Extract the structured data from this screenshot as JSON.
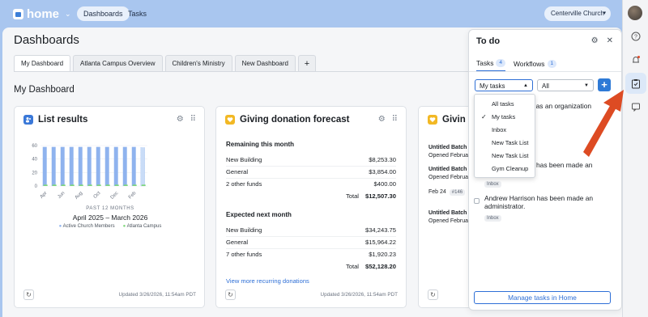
{
  "topbar": {
    "app_name": "home",
    "nav": [
      "Dashboards",
      "Tasks"
    ],
    "church_selector": "Centerville Church"
  },
  "page": {
    "title": "Dashboards",
    "tabs": [
      "My Dashboard",
      "Atlanta Campus Overview",
      "Children's Ministry",
      "New Dashboard",
      "+"
    ],
    "section_title": "My Dashboard"
  },
  "cards": {
    "list_results": {
      "title": "List results",
      "footer_period": "PAST 12 MONTHS",
      "footer_range": "April 2025 – March 2026",
      "updated": "Updated 3/26/2026, 11:54am PDT"
    },
    "giving_forecast": {
      "title": "Giving donation forecast",
      "remaining_header": "Remaining this month",
      "remaining_rows": [
        {
          "label": "New Building",
          "value": "$8,253.30"
        },
        {
          "label": "General",
          "value": "$3,854.00"
        },
        {
          "label": "2 other funds",
          "value": "$400.00"
        }
      ],
      "remaining_total_label": "Total",
      "remaining_total": "$12,507.30",
      "expected_header": "Expected next month",
      "expected_rows": [
        {
          "label": "New Building",
          "value": "$34,243.75"
        },
        {
          "label": "General",
          "value": "$15,964.22"
        },
        {
          "label": "7 other funds",
          "value": "$1,920.23"
        }
      ],
      "expected_total_label": "Total",
      "expected_total": "$52,128.20",
      "link": "View more recurring donations",
      "updated": "Updated 3/26/2026, 11:54am PDT"
    },
    "third": {
      "title": "Givin",
      "rows": [
        "Untitled Batch",
        "Opened Februa",
        "Untitled Batch",
        "Opened Februa",
        "Feb 24",
        "Untitled Batch",
        "Opened Februa"
      ],
      "feb_tag": "#146"
    }
  },
  "chart_data": {
    "type": "bar",
    "categories": [
      "Apr",
      "May",
      "Jun",
      "Jul",
      "Aug",
      "Sep",
      "Oct",
      "Nov",
      "Dec",
      "Jan",
      "Feb",
      "Mar"
    ],
    "tick_labels": [
      "Apr",
      "Jun",
      "Aug",
      "Oct",
      "Dec",
      "Feb"
    ],
    "series": [
      {
        "name": "Active Church Members",
        "color": "#8fb3ee",
        "values": [
          58,
          58,
          58,
          58,
          58,
          58,
          58,
          58,
          58,
          58,
          58,
          57
        ]
      },
      {
        "name": "Atlanta Campus",
        "color": "#7ed77a",
        "values": [
          2,
          2,
          2,
          2,
          2,
          2,
          2,
          2,
          2,
          2,
          2,
          2
        ]
      }
    ],
    "ylim": [
      0,
      60
    ],
    "yticks": [
      0,
      20,
      40,
      60
    ],
    "legend": "bottom",
    "grid": true
  },
  "todo": {
    "title": "To do",
    "tabs": [
      {
        "label": "Tasks",
        "count": "4"
      },
      {
        "label": "Workflows",
        "count": "1"
      }
    ],
    "filter_selected": "My tasks",
    "filter_second": "All",
    "menu_items": [
      "All tasks",
      "My tasks",
      "Inbox",
      "New Task List",
      "New Task List",
      "Gym Cleanup"
    ],
    "menu_checked": "My tasks",
    "tasks": [
      {
        "text": "ed as an organization"
      },
      {
        "text": "has been made an",
        "tag": "Inbox"
      },
      {
        "text": "Andrew Harrison has been made an administrator.",
        "tag": "Inbox"
      }
    ],
    "manage_button": "Manage tasks in Home"
  },
  "rail": {
    "icons": [
      "help-icon",
      "bell-icon",
      "clipboard-icon",
      "chat-icon"
    ]
  },
  "colors": {
    "accent": "#2e6fd6",
    "arrow": "#dd4b23",
    "background": "#a9c6ef"
  }
}
